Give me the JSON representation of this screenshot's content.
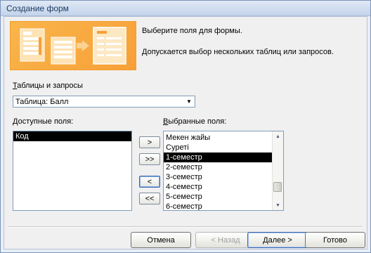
{
  "window": {
    "title": "Создание форм"
  },
  "description": {
    "line1": "Выберите поля для формы.",
    "line2": "Допускается выбор нескольких таблиц или запросов."
  },
  "tables": {
    "label_first": "Т",
    "label_rest": "аблицы и запросы",
    "selected": "Таблица: Балл",
    "arrow": "▼"
  },
  "available": {
    "label_first": "Д",
    "label_rest": "оступные поля:",
    "items": [
      {
        "label": "Код",
        "selected": true
      }
    ]
  },
  "chosen": {
    "label_first": "В",
    "label_rest": "ыбранные поля:",
    "items": [
      {
        "label": "Мекен жайы",
        "selected": false
      },
      {
        "label": "Суреті",
        "selected": false
      },
      {
        "label": "1-семестр",
        "selected": true
      },
      {
        "label": "2-семестр",
        "selected": false
      },
      {
        "label": "3-семестр",
        "selected": false
      },
      {
        "label": "4-семестр",
        "selected": false
      },
      {
        "label": "5-семестр",
        "selected": false
      },
      {
        "label": "6-семестр",
        "selected": false
      }
    ],
    "scroll_up": "▲",
    "scroll_down": "▼"
  },
  "move_buttons": {
    "add_one": ">",
    "add_all": ">>",
    "remove_one": "<",
    "remove_all": "<<"
  },
  "footer": {
    "cancel": "Отмена",
    "back": "< Назад",
    "next": "Далее >",
    "finish": "Готово"
  }
}
